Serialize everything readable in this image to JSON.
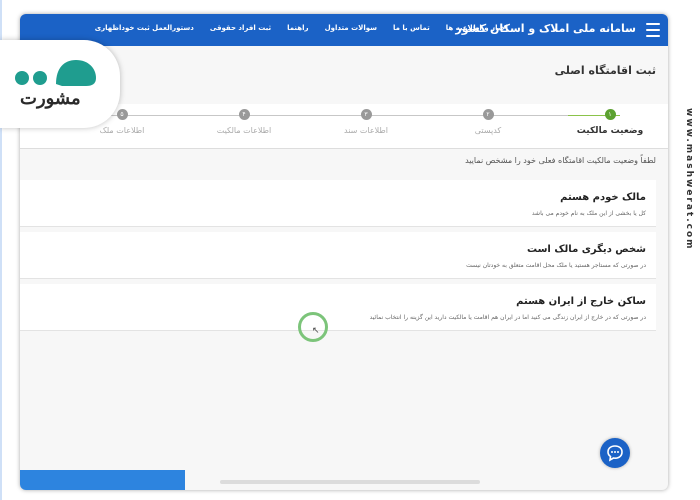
{
  "header": {
    "brand": "سامانه ملی املاک و اسکان کشور",
    "nav": [
      "اخبار و اطلاعیه ها",
      "تماس با ما",
      "سوالات متداول",
      "راهنما",
      "ثبت افراد حقوقی",
      "دستورالعمل ثبت خوداظهاری"
    ]
  },
  "page": {
    "title": "ثبت اقامتگاه اصلی"
  },
  "stepper": {
    "steps": [
      {
        "num": "۱",
        "label": "وضعیت مالکیت"
      },
      {
        "num": "۲",
        "label": "کدپستی"
      },
      {
        "num": "۳",
        "label": "اطلاعات سند"
      },
      {
        "num": "۴",
        "label": "اطلاعات مالکیت"
      },
      {
        "num": "۵",
        "label": "اطلاعات ملک"
      }
    ],
    "active_index": 0
  },
  "prompt": "لطفاً وضعیت مالکیت اقامتگاه فعلی خود را مشخص نمایید",
  "options": [
    {
      "title": "مالک خودم هستم",
      "desc": "کل یا بخشی از این ملک به نام خودم می باشد"
    },
    {
      "title": "شخص دیگری مالک است",
      "desc": "در صورتی که مستاجر هستید یا ملک محل اقامت متعلق به خودتان نیست"
    },
    {
      "title": "ساکن خارج از ایران هستم",
      "desc": "در صورتی که در خارج از ایران زندگی می کنید اما در ایران هم اقامت یا مالکیت دارید این گزینه را انتخاب نمائید"
    }
  ],
  "logo": {
    "text": "مشورت"
  },
  "watermark": "www.mashwerat.com",
  "colors": {
    "header": "#1b62c6",
    "active_step": "#5ca130",
    "cursor_ring": "#7cc47a"
  },
  "icons": {
    "menu": "hamburger-icon",
    "chat": "chat-bubble-icon",
    "cursor": "mouse-cursor-icon"
  }
}
